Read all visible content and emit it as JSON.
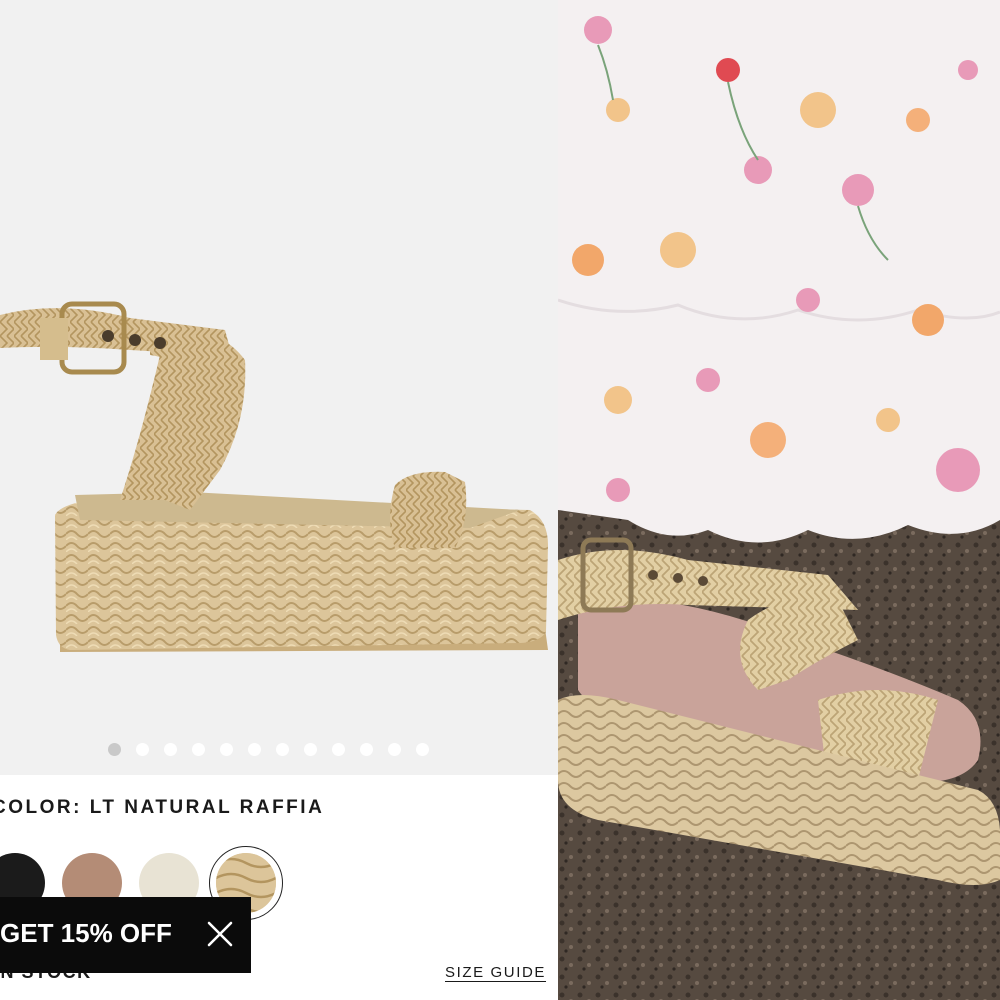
{
  "product": {
    "color_label": "COLOR: LT NATURAL RAFFIA",
    "stock_text": "IN STOCK",
    "size_guide_label": "SIZE GUIDE",
    "gallery_dot_count": 12,
    "gallery_active_index": 0,
    "swatches": [
      {
        "name": "black",
        "color": "#1b1b1b"
      },
      {
        "name": "tan",
        "color": "#b48c76"
      },
      {
        "name": "cream",
        "color": "#e8e3d4"
      },
      {
        "name": "lt natural raffia",
        "color": "#dcc59a",
        "selected": true
      }
    ]
  },
  "promo": {
    "text": "GET 15% OFF"
  },
  "colors": {
    "promo_bg": "#0b0b0b",
    "raffia": "#dcc59a",
    "image_bg": "#f1f1f1"
  },
  "icons": {
    "close": "close-icon"
  }
}
